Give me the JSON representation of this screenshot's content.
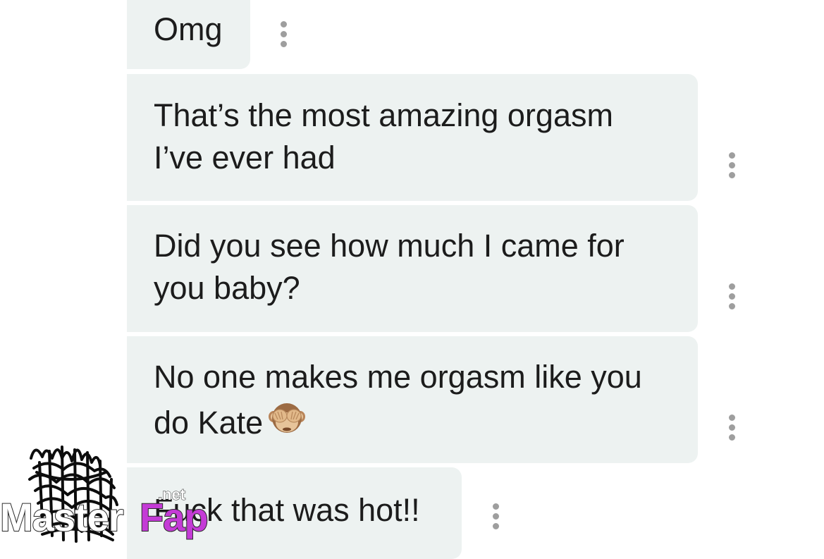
{
  "messages": [
    {
      "text": "Omg"
    },
    {
      "text": "That’s the most amazing orgasm\nI’ve ever had"
    },
    {
      "text": "Did you see how much I came for\nyou baby?"
    },
    {
      "text": "No one makes me orgasm like you\ndo Kate",
      "emoji": "see-no-evil-monkey"
    },
    {
      "text": "Fuck that was hot!!"
    }
  ],
  "watermark": {
    "brand_first": "Master",
    "brand_second": "Fap",
    "suffix": ".net"
  },
  "colors": {
    "bubble_bg": "#edf2f1",
    "text": "#1c1c1c",
    "menu_dots": "#9e9e9e",
    "watermark_accent": "#c43bd6"
  },
  "icons": {
    "message_menu": "vertical-ellipsis-icon",
    "emoji": "see-no-evil-monkey-icon"
  }
}
